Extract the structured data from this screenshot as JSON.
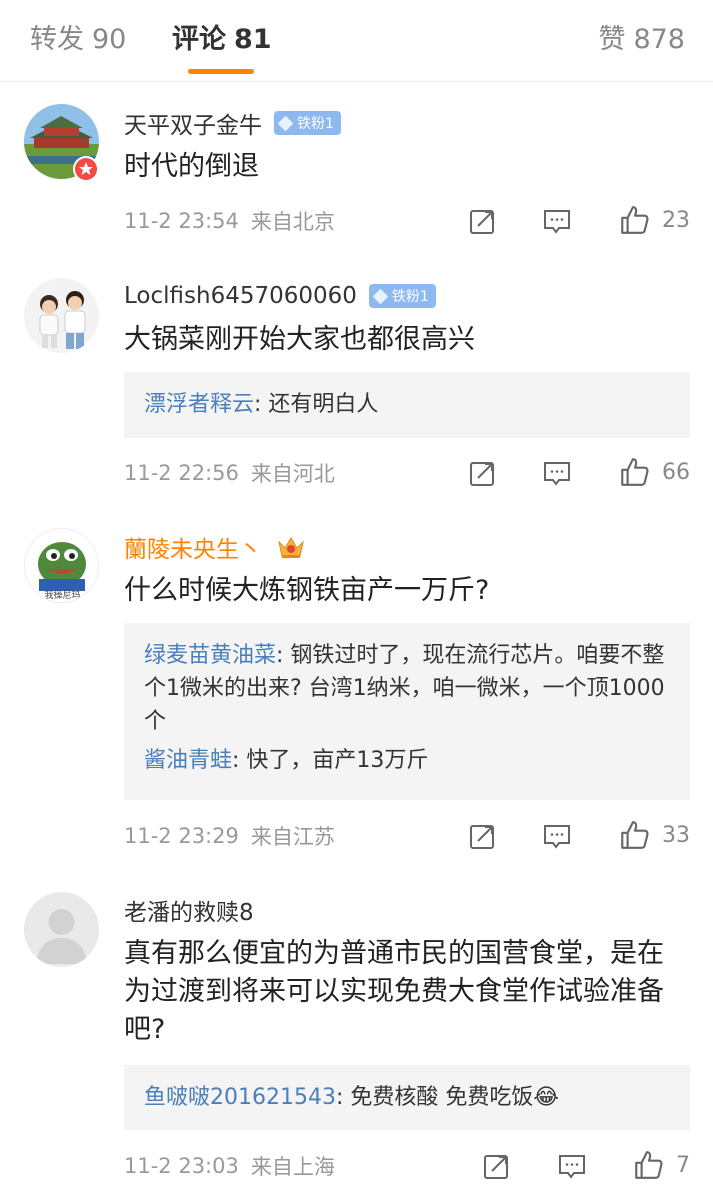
{
  "tabs": {
    "repost": {
      "label": "转发",
      "count": "90"
    },
    "comments": {
      "label": "评论",
      "count": "81"
    },
    "likes": {
      "label": "赞",
      "count": "878"
    }
  },
  "colors": {
    "accent": "#ff8200",
    "reply_user": "#4a7fba",
    "badge": "#8db9f0"
  },
  "comments": [
    {
      "username": "天平双子金牛",
      "badge": "铁粉1",
      "text": "时代的倒退",
      "time": "11-2 23:54",
      "location": "来自北京",
      "likes": "23"
    },
    {
      "username": "Loclfish6457060060",
      "badge": "铁粉1",
      "text": "大锅菜刚开始大家也都很高兴",
      "replies": [
        {
          "user": "漂浮者释云",
          "text": ": 还有明白人"
        }
      ],
      "time": "11-2 22:56",
      "location": "来自河北",
      "likes": "66"
    },
    {
      "username": "蘭陵未央生丶",
      "text": "什么时候大炼钢铁亩产一万斤?",
      "avatar_caption": "我操尼玛",
      "replies": [
        {
          "user": "绿麦苗黄油菜",
          "text": ": 钢铁过时了，现在流行芯片。咱要不整个1微米的出来? 台湾1纳米，咱一微米，一个顶1000个"
        },
        {
          "user": "酱油青蛙",
          "text": ": 快了，亩产13万斤"
        }
      ],
      "time": "11-2 23:29",
      "location": "来自江苏",
      "likes": "33"
    },
    {
      "username": "老潘的救赎8",
      "text": "真有那么便宜的为普通市民的国营食堂，是在为过渡到将来可以实现免费大食堂作试验准备吧?",
      "replies": [
        {
          "user": "鱼啵啵201621543",
          "text": ": 免费核酸 免费吃饭😂"
        }
      ],
      "time": "11-2 23:03",
      "location": "来自上海",
      "likes": "7"
    }
  ]
}
